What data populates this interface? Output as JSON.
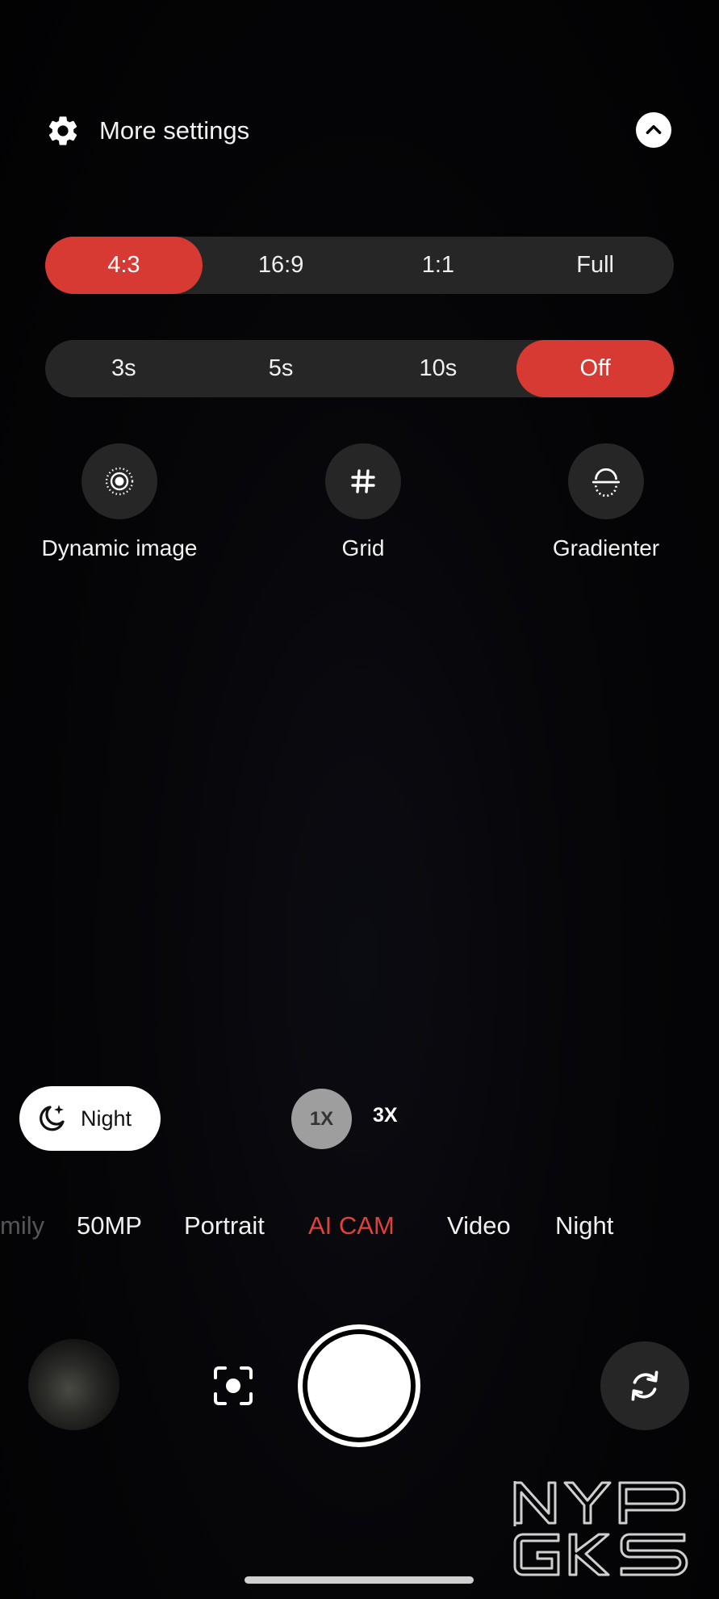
{
  "header": {
    "title": "More settings",
    "settings_icon": "gear-icon",
    "collapse_icon": "chevron-up-icon"
  },
  "aspect_ratio": {
    "options": [
      "4:3",
      "16:9",
      "1:1",
      "Full"
    ],
    "selected": "4:3"
  },
  "timer": {
    "options": [
      "3s",
      "5s",
      "10s",
      "Off"
    ],
    "selected": "Off"
  },
  "features": [
    {
      "label": "Dynamic image",
      "icon": "dynamic-image-icon"
    },
    {
      "label": "Grid",
      "icon": "grid-icon"
    },
    {
      "label": "Gradienter",
      "icon": "level-icon"
    }
  ],
  "night_toggle": {
    "label": "Night",
    "icon": "moon-sparkle-icon"
  },
  "zoom": {
    "options": [
      "1X",
      "3X"
    ],
    "selected": "1X"
  },
  "modes": {
    "items": [
      "mily",
      "50MP",
      "Portrait",
      "AI CAM",
      "Video",
      "Night"
    ],
    "active": "AI CAM"
  },
  "bottom": {
    "gallery_icon": "gallery-thumbnail",
    "scan_icon": "scan-focus-icon",
    "shutter": "shutter-button",
    "flip_icon": "switch-camera-icon"
  },
  "watermark": {
    "text_line1": "NYP",
    "text_line2": "GKS"
  },
  "colors": {
    "accent": "#d63a32",
    "pill_bg": "#262626",
    "background": "#050507"
  }
}
